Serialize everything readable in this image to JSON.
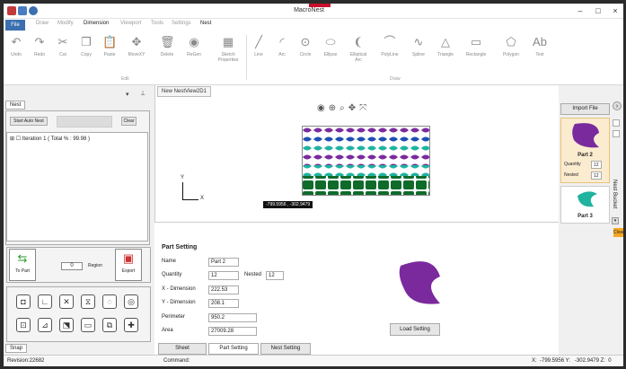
{
  "window": {
    "title": "MacroNest"
  },
  "menu": [
    "File",
    "Draw",
    "Modify",
    "Dimension",
    "Viewport",
    "Tools",
    "Settings",
    "Nest"
  ],
  "ribbon": {
    "edit_tools": [
      "Undo",
      "Redo",
      "Cut",
      "Copy",
      "Paste",
      "MoveXY",
      "Delete",
      "ReGen",
      "Sketch Properties"
    ],
    "draw_tools": [
      "Line",
      "Arc",
      "Circle",
      "Ellipse",
      "Elliptical Arc",
      "PolyLine",
      "Spline",
      "Triangle",
      "Rectangle",
      "Polygon",
      "Text"
    ],
    "groups": [
      "Edit",
      "Draw"
    ]
  },
  "left_panel": {
    "tab": "Nest",
    "start_button": "Start Auto Nest",
    "clear_button": "Clear",
    "tree_item": "Iteration 1 ( Total % : 99.98 )",
    "to_part": "To Part",
    "region_label": "Region",
    "region_value": "0",
    "export": "Export",
    "bottom_tab": "Snap"
  },
  "canvas": {
    "doc_tab": "New NestView2D1",
    "coord_tag": "-799.5956 , -302.9479",
    "axis_x": "X",
    "axis_y": "Y"
  },
  "right_panel": {
    "import_button": "Import File",
    "side_label": "Nest Bucket",
    "close_button": "Close",
    "part2": {
      "name": "Part 2",
      "quantity_label": "Quantity",
      "quantity": "12",
      "nested_label": "Nested",
      "nested": "12"
    },
    "part3": {
      "name": "Part 3"
    }
  },
  "part_setting": {
    "title": "Part Setting",
    "name_label": "Name",
    "name": "Part 2",
    "quantity_label": "Quantity",
    "quantity": "12",
    "nested_label": "Nested",
    "nested": "12",
    "xdim_label": "X - Dimension",
    "xdim": "222.53",
    "ydim_label": "Y - Dimension",
    "ydim": "208.1",
    "perimeter_label": "Perimeter",
    "perimeter": "950.2",
    "area_label": "Area",
    "area": "27009.28",
    "load_button": "Load Setting",
    "tabs": [
      "Sheet",
      "Part Setting",
      "Nest Setting"
    ]
  },
  "status": {
    "revision": "Revision:22682",
    "command": "Command:",
    "coords": "X:  -799.5956 Y:   -302.9479 Z:  0"
  },
  "colors": {
    "accent": "#3a6fb0",
    "part_purple": "#7b2a9e",
    "part_teal": "#1fb3a0",
    "card": "#fbecd0"
  }
}
